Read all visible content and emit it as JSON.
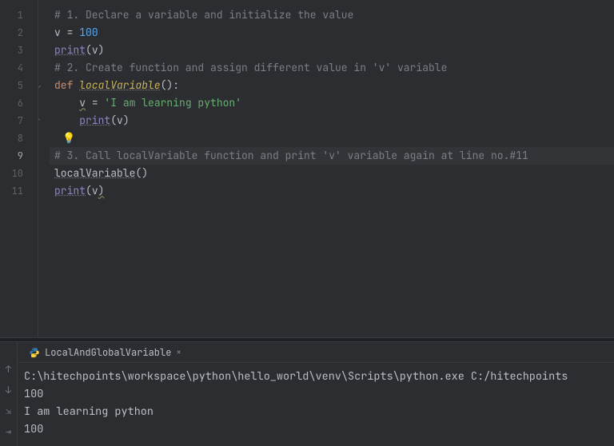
{
  "editor": {
    "active_line": 9,
    "lines": [
      {
        "n": 1,
        "tokens": [
          [
            "# 1. Declare a variable and initialize the value",
            "c-comment"
          ]
        ]
      },
      {
        "n": 2,
        "tokens": [
          [
            "v",
            "c-var"
          ],
          [
            " = ",
            "c-op"
          ],
          [
            "100",
            "c-num"
          ]
        ]
      },
      {
        "n": 3,
        "tokens": [
          [
            "print",
            "c-builtin"
          ],
          [
            "(",
            "c-op"
          ],
          [
            "v",
            "c-var"
          ],
          [
            ")",
            "c-op"
          ]
        ]
      },
      {
        "n": 4,
        "tokens": [
          [
            "# 2. Create function and assign different value in 'v' variable",
            "c-comment"
          ]
        ]
      },
      {
        "n": 5,
        "fold": "open",
        "tokens": [
          [
            "def ",
            "c-kw"
          ],
          [
            "localVariable",
            "c-fn"
          ],
          [
            "():",
            "c-op"
          ]
        ]
      },
      {
        "n": 6,
        "tokens": [
          [
            "    ",
            ""
          ],
          [
            "v",
            "c-var c-warn"
          ],
          [
            " = ",
            "c-op"
          ],
          [
            "'I am learning python'",
            "c-str"
          ]
        ]
      },
      {
        "n": 7,
        "fold": "close",
        "tokens": [
          [
            "    ",
            ""
          ],
          [
            "print",
            "c-builtin"
          ],
          [
            "(",
            "c-op"
          ],
          [
            "v",
            "c-var"
          ],
          [
            ")",
            "c-op"
          ]
        ]
      },
      {
        "n": 8,
        "bulb": true,
        "tokens": []
      },
      {
        "n": 9,
        "tokens": [
          [
            "# 3. Call localVariable function and print 'v' variable again at line no.#11",
            "c-comment"
          ]
        ]
      },
      {
        "n": 10,
        "tokens": [
          [
            "localVariable",
            "c-call"
          ],
          [
            "()",
            "c-op"
          ]
        ]
      },
      {
        "n": 11,
        "tokens": [
          [
            "print",
            "c-builtin"
          ],
          [
            "(",
            "c-op"
          ],
          [
            "v",
            "c-var"
          ],
          [
            ")",
            "c-op c-warn"
          ]
        ]
      }
    ]
  },
  "run": {
    "tab_label": "LocalAndGlobalVariable",
    "toolstrip": {
      "up": "↑",
      "down": "↓",
      "soft": "⇲",
      "wrap": "⇥"
    },
    "output": [
      "C:\\hitechpoints\\workspace\\python\\hello_world\\venv\\Scripts\\python.exe C:/hitechpoints",
      "100",
      "I am learning python",
      "100"
    ]
  },
  "icons": {
    "bulb": "💡",
    "close": "×"
  }
}
